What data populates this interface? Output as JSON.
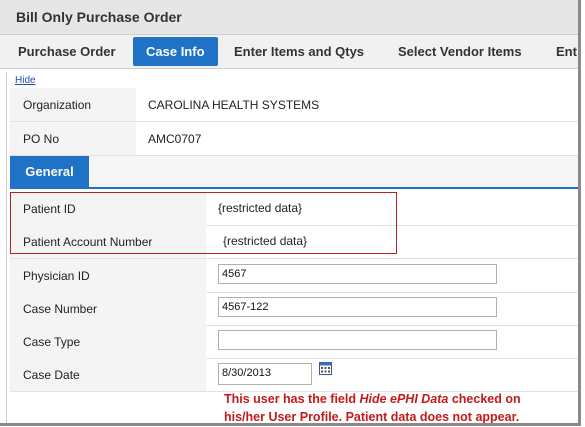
{
  "window": {
    "title": "Bill Only Purchase Order"
  },
  "tabs": [
    {
      "label": "Purchase Order",
      "active": false
    },
    {
      "label": "Case Info",
      "active": true
    },
    {
      "label": "Enter Items and Qtys",
      "active": false
    },
    {
      "label": "Select Vendor Items",
      "active": false
    },
    {
      "label": "Ent",
      "active": false
    }
  ],
  "hide_link": "Hide",
  "header_rows": [
    {
      "label": "Organization",
      "value": "CAROLINA  HEALTH SYSTEMS"
    },
    {
      "label": "PO No",
      "value": "AMC0707"
    }
  ],
  "section_tab": "General",
  "restricted_rows": [
    {
      "label": "Patient ID",
      "value": "{restricted data}"
    },
    {
      "label": "Patient Account Number",
      "value": "{restricted data}"
    }
  ],
  "fields": [
    {
      "label": "Physician ID",
      "value": "4567"
    },
    {
      "label": "Case Number",
      "value": "4567-122"
    },
    {
      "label": "Case Type",
      "value": ""
    },
    {
      "label": "Case Date",
      "value": "8/30/2013"
    }
  ],
  "note": {
    "line1_prefix": "This user has the field ",
    "line1_em": "Hide ePHI Data",
    "line1_suffix": " checked on",
    "line2": "his/her User Profile. Patient data does not appear."
  },
  "colors": {
    "accent": "#1f72c6",
    "annotation": "#c41a1a"
  },
  "icons": {
    "date_picker": "calendar-icon"
  }
}
